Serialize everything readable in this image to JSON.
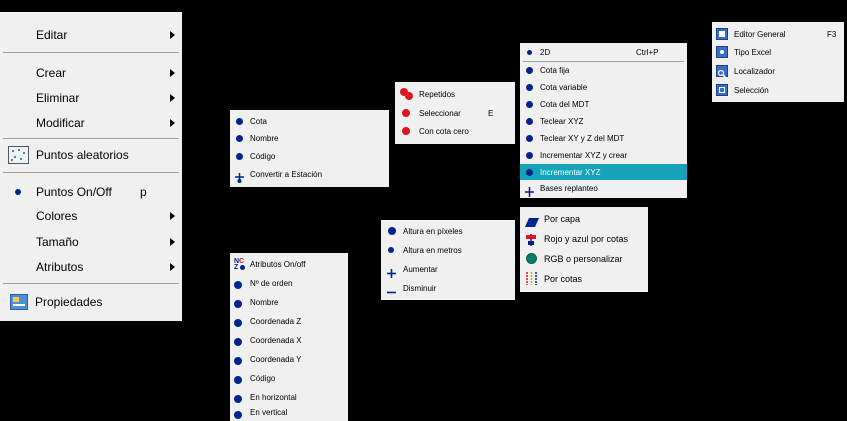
{
  "main_menu": {
    "editar": "Editar",
    "crear": "Crear",
    "eliminar": "Eliminar",
    "modificar": "Modificar",
    "puntos_aleatorios": "Puntos aleatorios",
    "puntos_onoff": "Puntos On/Off",
    "puntos_onoff_shortcut": "p",
    "colores": "Colores",
    "tamano": "Tamaño",
    "atributos": "Atributos",
    "propiedades": "Propiedades"
  },
  "crear_menu": {
    "items": [
      "Cota",
      "Nombre",
      "Código",
      "Convertir a Estación"
    ]
  },
  "eliminar_menu": {
    "items": [
      "Repetidos",
      "Seleccionar",
      "Con cota cero"
    ],
    "seleccionar_shortcut": "E"
  },
  "modificar_menu": {
    "items": [
      "2D",
      "Cota fija",
      "Cota variable",
      "Cota del MDT",
      "Teclear XYZ",
      "Teclear XY y Z del MDT",
      "Incrementar XYZ y crear",
      "Incrementar XYZ",
      "Bases replanteo"
    ],
    "shortcut_2d": "Ctrl+P",
    "highlighted_index": 7
  },
  "tamano_menu": {
    "items": [
      "Altura en píxeles",
      "Altura en metros",
      "Aumentar",
      "Disminuir"
    ]
  },
  "colores_menu": {
    "items": [
      "Por capa",
      "Rojo y azul por cotas",
      "RGB o personalizar",
      "Por cotas"
    ]
  },
  "atributos_menu": {
    "items": [
      "Atributos On/off",
      "Nº de orden",
      "Nombre",
      "Coordenada Z",
      "Coordenada X",
      "Coordenada Y",
      "Código",
      "En horizontal",
      "En vertical"
    ]
  },
  "tool_menu": {
    "items": [
      "Editor General",
      "Tipo Excel",
      "Localizador",
      "Selección"
    ],
    "editor_shortcut": "F3"
  },
  "colors": {
    "menu_bg": "#f0f0f0",
    "highlight": "#16a2b8",
    "icon_blue": "#00238f",
    "icon_red": "#e0141e"
  }
}
